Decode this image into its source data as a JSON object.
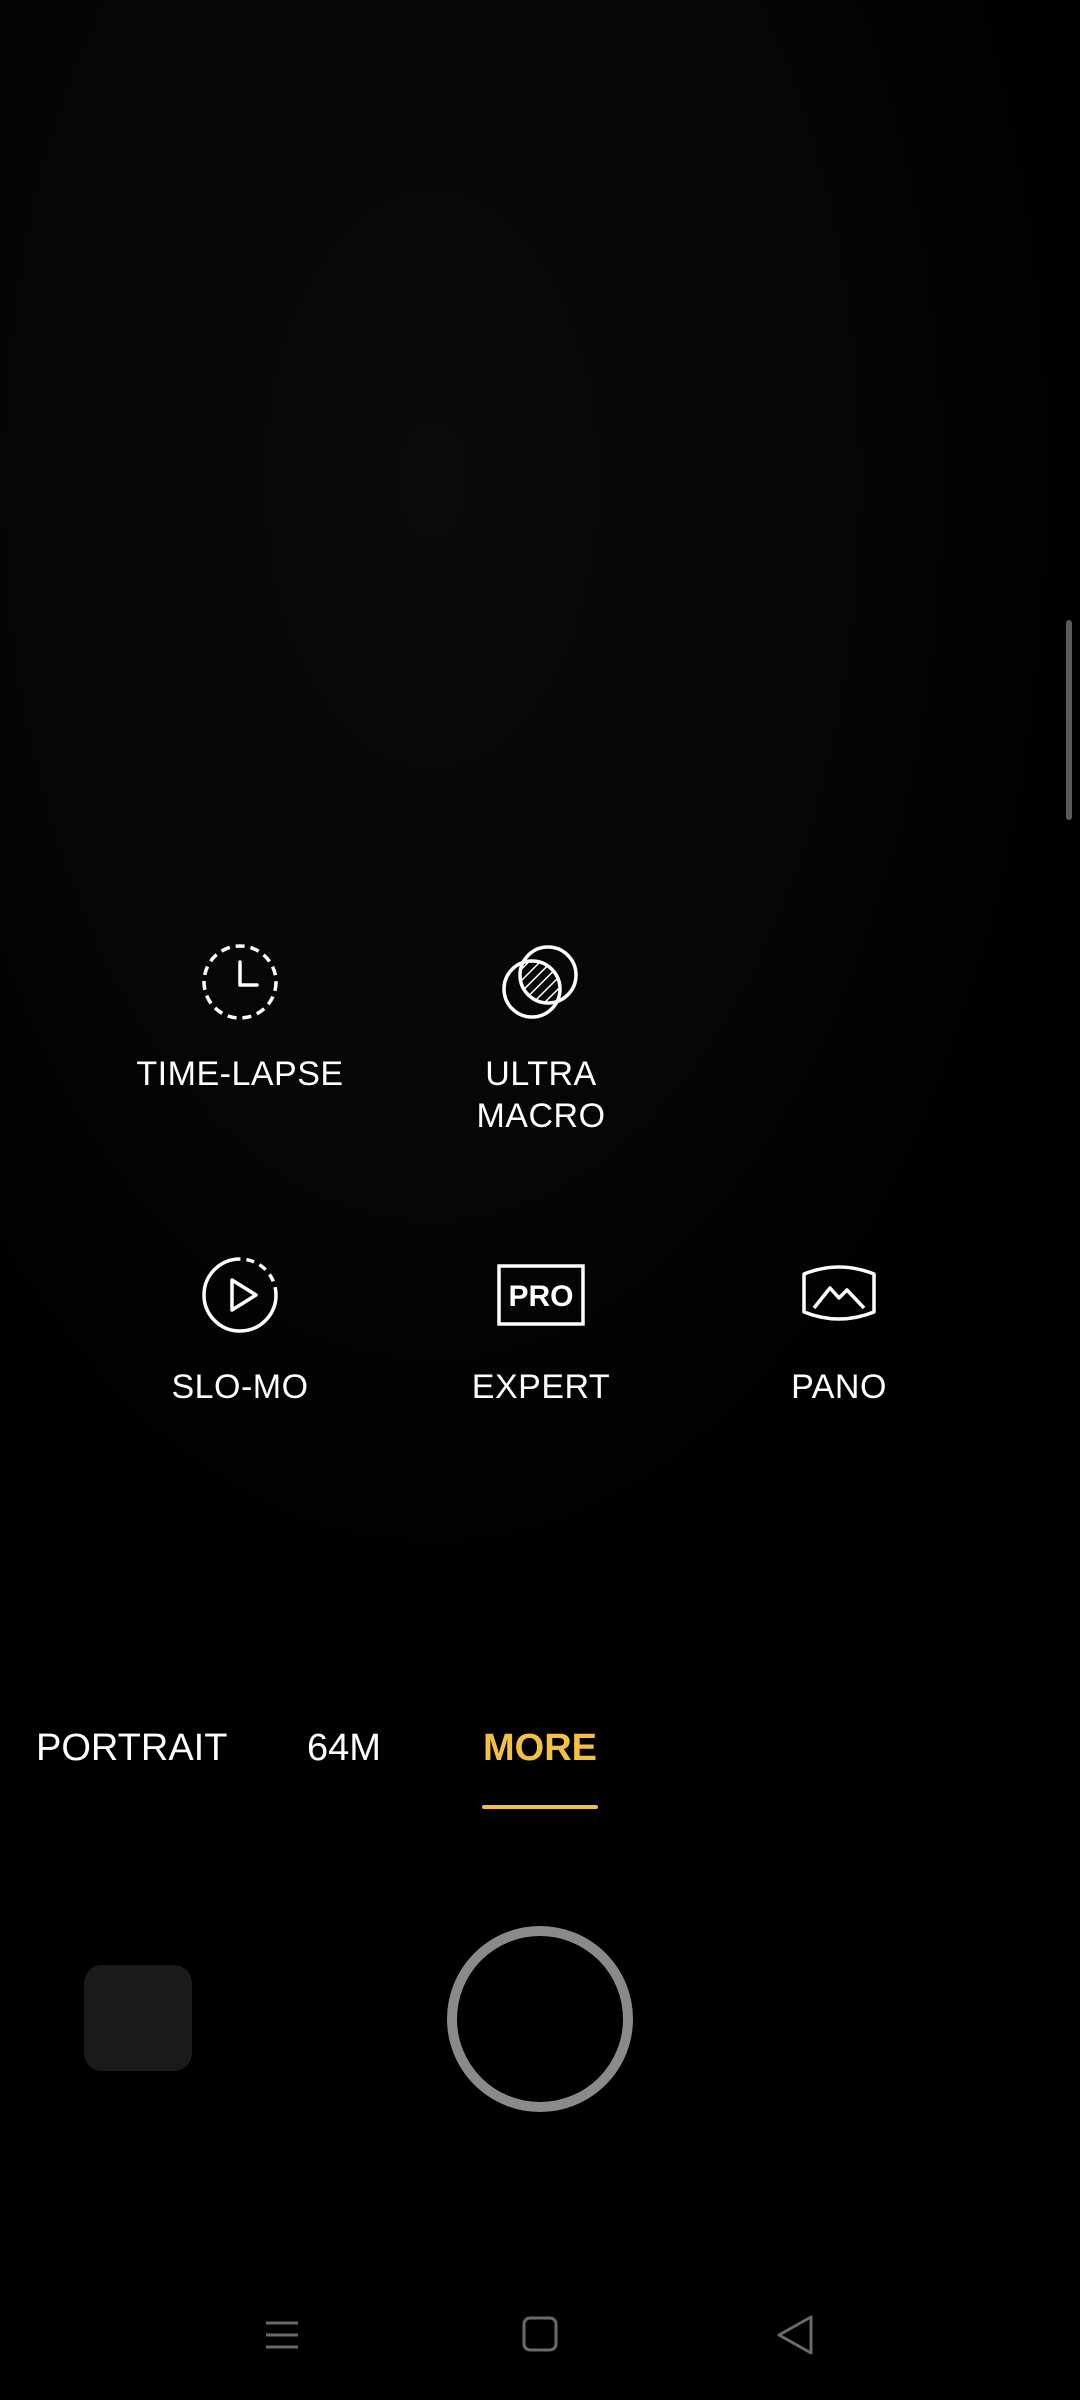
{
  "camera": {
    "modes_grid": [
      {
        "id": "time-lapse",
        "label": "TIME-LAPSE",
        "icon": "timelapse-icon"
      },
      {
        "id": "ultra-macro",
        "label": "ULTRA\nMACRO",
        "icon": "ultra-macro-icon"
      },
      {
        "id": "slo-mo",
        "label": "SLO-MO",
        "icon": "slomo-icon"
      },
      {
        "id": "expert",
        "label": "EXPERT",
        "icon": "pro-icon",
        "icon_text": "PRO"
      },
      {
        "id": "pano",
        "label": "PANO",
        "icon": "panorama-icon"
      }
    ],
    "mode_bar": {
      "tabs": [
        {
          "label": "PORTRAIT"
        },
        {
          "label": "64M"
        },
        {
          "label": "MORE",
          "active": true
        }
      ]
    }
  },
  "colors": {
    "accent": "#f4c041",
    "background": "#000000",
    "shutter_ring": "#8a8a8a",
    "thumb": "#1a1a1a"
  },
  "nav_bar": {
    "buttons": [
      {
        "name": "menu",
        "icon": "menu-lines-icon"
      },
      {
        "name": "home",
        "icon": "square-home-icon"
      },
      {
        "name": "back",
        "icon": "triangle-back-icon"
      }
    ]
  }
}
